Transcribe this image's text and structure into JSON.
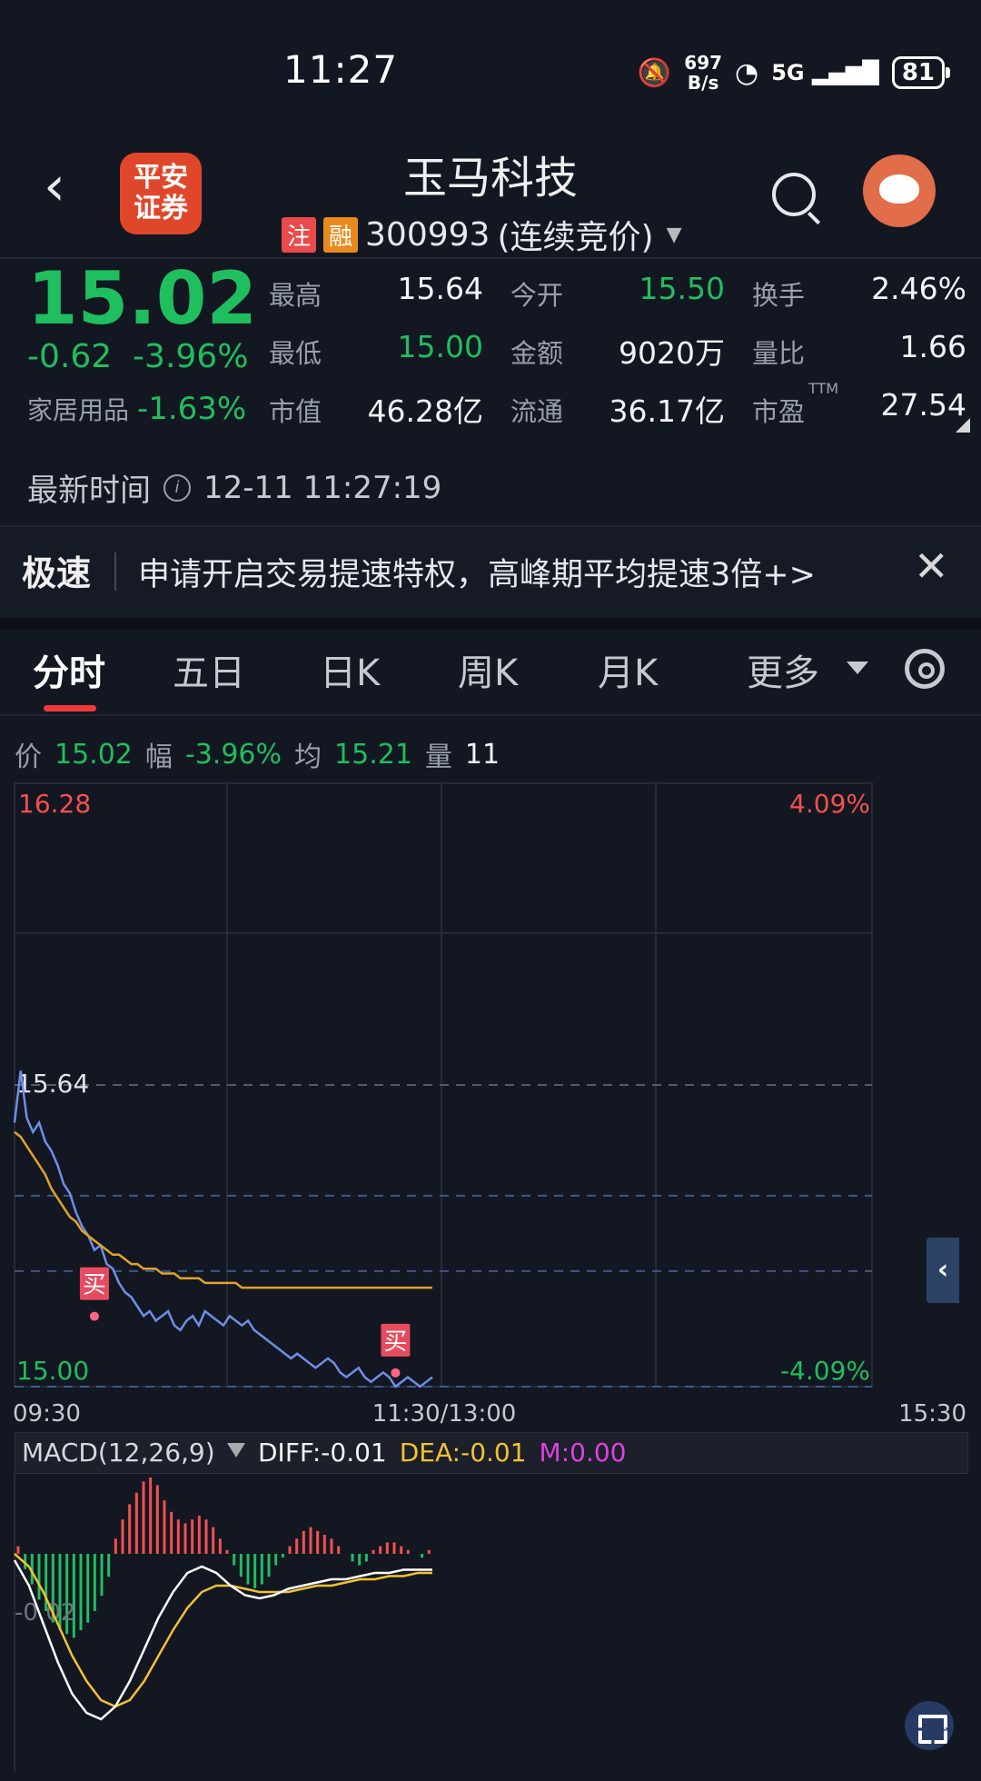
{
  "status_bar": {
    "time": "11:27",
    "net_speed": "697",
    "net_unit": "B/s",
    "signal": "5G",
    "battery": "81"
  },
  "header": {
    "logo_text": "平安证券",
    "stock_name": "玉马科技",
    "tag_zhu": "注",
    "tag_rong": "融",
    "code": "300993",
    "trading_status": "(连续竞价)"
  },
  "quote": {
    "price": "15.02",
    "change": "-0.62",
    "change_pct": "-3.96%",
    "sector_name": "家居用品",
    "sector_pct": "-1.63%",
    "fields": [
      {
        "label": "最高",
        "value": "15.64",
        "color": "white"
      },
      {
        "label": "今开",
        "value": "15.50",
        "color": "green"
      },
      {
        "label": "换手",
        "value": "2.46%",
        "color": "white"
      },
      {
        "label": "最低",
        "value": "15.00",
        "color": "green"
      },
      {
        "label": "金额",
        "value": "9020万",
        "color": "white"
      },
      {
        "label": "量比",
        "value": "1.66",
        "color": "white"
      },
      {
        "label": "市值",
        "value": "46.28亿",
        "color": "white"
      },
      {
        "label": "流通",
        "value": "36.17亿",
        "color": "white"
      },
      {
        "label": "市盈",
        "value": "27.54",
        "color": "white"
      }
    ],
    "pe_sup": "TTM",
    "update_label": "最新时间",
    "update_time": "12-11 11:27:19"
  },
  "banner": {
    "tag": "极速",
    "text": "申请开启交易提速特权，高峰期平均提速3倍+>",
    "close": "✕"
  },
  "tabs": [
    "分时",
    "五日",
    "日K",
    "周K",
    "月K",
    "更多"
  ],
  "info_line": {
    "price_label": "价",
    "price_value": "15.02",
    "amp_label": "幅",
    "amp_value": "-3.96%",
    "avg_label": "均",
    "avg_value": "15.21",
    "vol_label": "量",
    "vol_value": "11"
  },
  "chart_data": {
    "type": "line",
    "y_top_label": "16.28",
    "y_top_pct": "4.09%",
    "y_bottom_label": "15.00",
    "y_bottom_pct": "-4.09%",
    "high_line_label": "15.64",
    "x_labels": [
      "09:30",
      "11:30/13:00",
      "15:30"
    ],
    "ylim": [
      15.0,
      16.28
    ],
    "buy_marker_label": "买",
    "series": [
      {
        "values": [
          15.56,
          15.67,
          15.57,
          15.54,
          15.56,
          15.52,
          15.5,
          15.47,
          15.43,
          15.41,
          15.37,
          15.34,
          15.32,
          15.29,
          15.3,
          15.26,
          15.25,
          15.22,
          15.2,
          15.19,
          15.17,
          15.15,
          15.16,
          15.14,
          15.15,
          15.16,
          15.13,
          15.12,
          15.14,
          15.15,
          15.13,
          15.16,
          15.15,
          15.14,
          15.13,
          15.15,
          15.14,
          15.13,
          15.14,
          15.12,
          15.11,
          15.1,
          15.09,
          15.08,
          15.07,
          15.06,
          15.07,
          15.06,
          15.05,
          15.04,
          15.05,
          15.06,
          15.05,
          15.03,
          15.02,
          15.03,
          15.04,
          15.02,
          15.01,
          15.02,
          15.03,
          15.02,
          15.0,
          15.01,
          15.02,
          15.01,
          15.0,
          15.01,
          15.02
        ]
      },
      {
        "values": [
          15.54,
          15.53,
          15.51,
          15.49,
          15.47,
          15.45,
          15.42,
          15.4,
          15.38,
          15.36,
          15.35,
          15.33,
          15.32,
          15.31,
          15.3,
          15.29,
          15.28,
          15.28,
          15.27,
          15.26,
          15.26,
          15.25,
          15.25,
          15.25,
          15.24,
          15.24,
          15.24,
          15.23,
          15.23,
          15.23,
          15.23,
          15.22,
          15.22,
          15.22,
          15.22,
          15.22,
          15.22,
          15.21,
          15.21,
          15.21,
          15.21,
          15.21,
          15.21,
          15.21,
          15.21,
          15.21,
          15.21,
          15.21,
          15.21,
          15.21,
          15.21,
          15.21,
          15.21,
          15.21,
          15.21,
          15.21,
          15.21,
          15.21,
          15.21,
          15.21,
          15.21,
          15.21,
          15.21,
          15.21,
          15.21,
          15.21,
          15.21,
          15.21,
          15.21
        ]
      }
    ],
    "buy_markers": [
      {
        "index": 13,
        "value": 15.13
      },
      {
        "index": 62,
        "value": 15.01
      }
    ]
  },
  "macd": {
    "title": "MACD(12,26,9)",
    "diff": "DIFF:-0.01",
    "dea": "DEA:-0.01",
    "m": "M:0.00",
    "axis_label": "-0.02",
    "hist": [
      0.002,
      -0.004,
      -0.008,
      -0.012,
      -0.015,
      -0.018,
      -0.02,
      -0.021,
      -0.022,
      -0.02,
      -0.018,
      -0.015,
      -0.011,
      -0.006,
      0.004,
      0.009,
      0.013,
      0.016,
      0.019,
      0.02,
      0.018,
      0.014,
      0.011,
      0.009,
      0.008,
      0.009,
      0.01,
      0.009,
      0.007,
      0.004,
      0.001,
      -0.003,
      -0.006,
      -0.008,
      -0.009,
      -0.008,
      -0.006,
      -0.003,
      -0.001,
      0.002,
      0.004,
      0.006,
      0.007,
      0.006,
      0.005,
      0.004,
      0.002,
      0.0,
      -0.002,
      -0.003,
      -0.002,
      0.001,
      0.002,
      0.003,
      0.003,
      0.002,
      0.001,
      0.0,
      -0.001,
      0.001
    ],
    "diff_line": [
      -0.002,
      -0.01,
      -0.022,
      -0.034,
      -0.044,
      -0.05,
      -0.052,
      -0.048,
      -0.04,
      -0.03,
      -0.02,
      -0.012,
      -0.006,
      -0.004,
      -0.006,
      -0.01,
      -0.013,
      -0.014,
      -0.013,
      -0.011,
      -0.01,
      -0.009,
      -0.008,
      -0.008,
      -0.007,
      -0.006,
      -0.006,
      -0.005,
      -0.005,
      -0.005
    ],
    "dea_line": [
      0.0,
      -0.004,
      -0.012,
      -0.022,
      -0.032,
      -0.04,
      -0.046,
      -0.048,
      -0.046,
      -0.04,
      -0.032,
      -0.024,
      -0.017,
      -0.012,
      -0.01,
      -0.01,
      -0.011,
      -0.012,
      -0.012,
      -0.012,
      -0.011,
      -0.01,
      -0.01,
      -0.009,
      -0.008,
      -0.008,
      -0.007,
      -0.007,
      -0.006,
      -0.006
    ]
  },
  "colors": {
    "price_line": "#6f8fe6",
    "avg_line": "#e2a32a",
    "down": "#1fbe5e",
    "up": "#f5504f",
    "diff": "#ffffff",
    "dea": "#f2c230",
    "m": "#e040e0"
  }
}
